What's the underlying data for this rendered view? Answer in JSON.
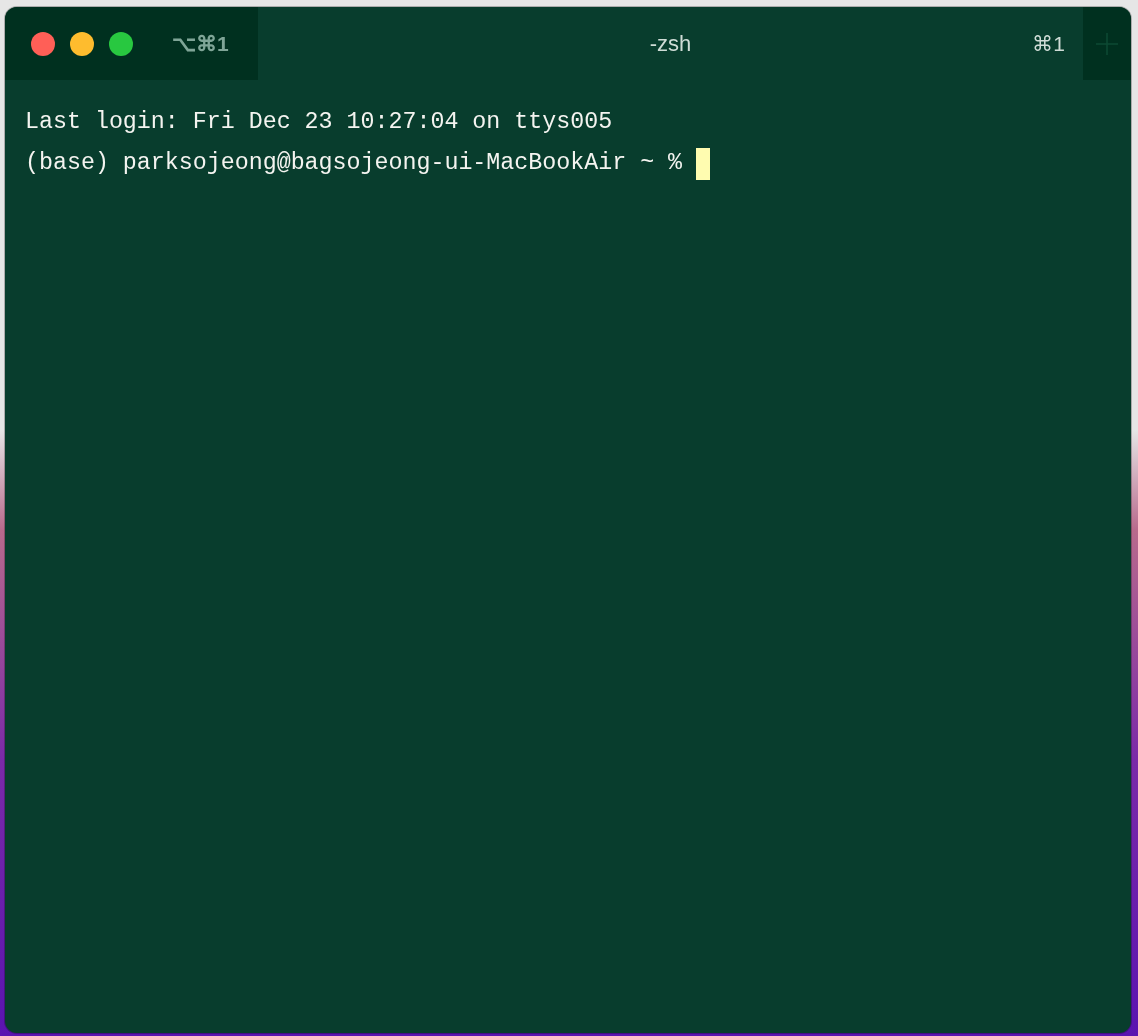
{
  "window": {
    "shortcut": "⌥⌘1"
  },
  "tabs": [
    {
      "title": "-zsh",
      "shortcut": "⌘1",
      "selected": true
    }
  ],
  "terminal": {
    "lines": [
      "Last login: Fri Dec 23 10:27:04 on ttys005"
    ],
    "prompt": "(base) parksojeong@bagsojeong-ui-MacBookAir ~ %",
    "cursor": true
  }
}
